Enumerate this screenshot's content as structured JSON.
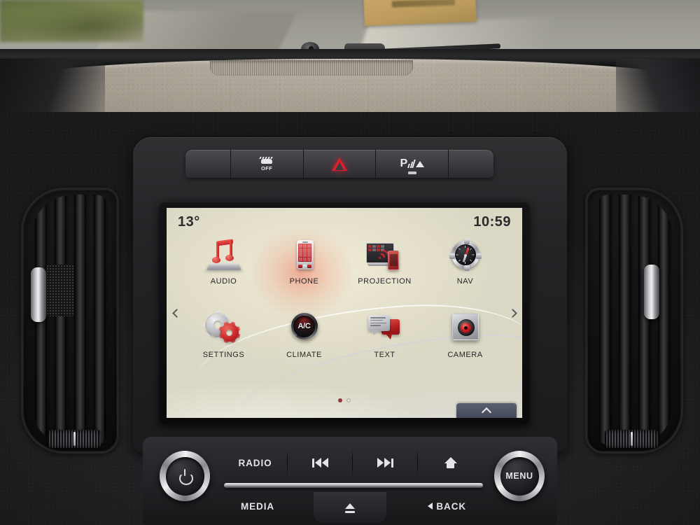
{
  "screen": {
    "status": {
      "temperature": "13°",
      "clock": "10:59"
    },
    "apps": [
      {
        "label": "AUDIO",
        "icon": "music-note-icon"
      },
      {
        "label": "PHONE",
        "icon": "smartphone-icon"
      },
      {
        "label": "PROJECTION",
        "icon": "screen-mirroring-icon"
      },
      {
        "label": "NAV",
        "icon": "compass-icon"
      },
      {
        "label": "SETTINGS",
        "icon": "gears-icon"
      },
      {
        "label": "CLIMATE",
        "icon": "ac-dial-icon"
      },
      {
        "label": "TEXT",
        "icon": "speech-bubbles-icon"
      },
      {
        "label": "CAMERA",
        "icon": "camera-lens-icon"
      }
    ],
    "pager": {
      "total": 2,
      "current": 1
    },
    "nav_prev_icon": "chevron-left-icon",
    "nav_next_icon": "chevron-right-icon",
    "pull_tab_icon": "chevron-up-icon"
  },
  "top_keys": [
    {
      "name": "blank-left",
      "label": "",
      "icon": "blank-icon"
    },
    {
      "name": "traction-control",
      "label": "OFF",
      "icon": "traction-control-off-icon"
    },
    {
      "name": "hazard-warning",
      "label": "",
      "icon": "hazard-triangle-icon"
    },
    {
      "name": "park-assist",
      "label": "P",
      "icon": "park-assist-icon"
    },
    {
      "name": "blank-right",
      "label": "",
      "icon": "blank-icon"
    }
  ],
  "bottom_controls": {
    "power_knob": {
      "label": "",
      "icon": "power-icon"
    },
    "menu_knob": {
      "label": "MENU",
      "icon": "menu-knob-icon"
    },
    "row1": [
      {
        "label": "RADIO",
        "icon": "radio-label"
      },
      {
        "label": "",
        "icon": "previous-track-icon"
      },
      {
        "label": "",
        "icon": "next-track-icon"
      },
      {
        "label": "",
        "icon": "home-icon"
      }
    ],
    "media_label": "MEDIA",
    "back_label": "BACK",
    "back_icon": "back-arrow-icon",
    "eject_icon": "eject-icon"
  },
  "colors": {
    "accent_red": "#cc2a2c",
    "hazard_red": "#d8202c",
    "lcd_bg": "#e8e4cf",
    "lcd_text": "#2c2c2e",
    "tab_blue": "#4a5160"
  }
}
